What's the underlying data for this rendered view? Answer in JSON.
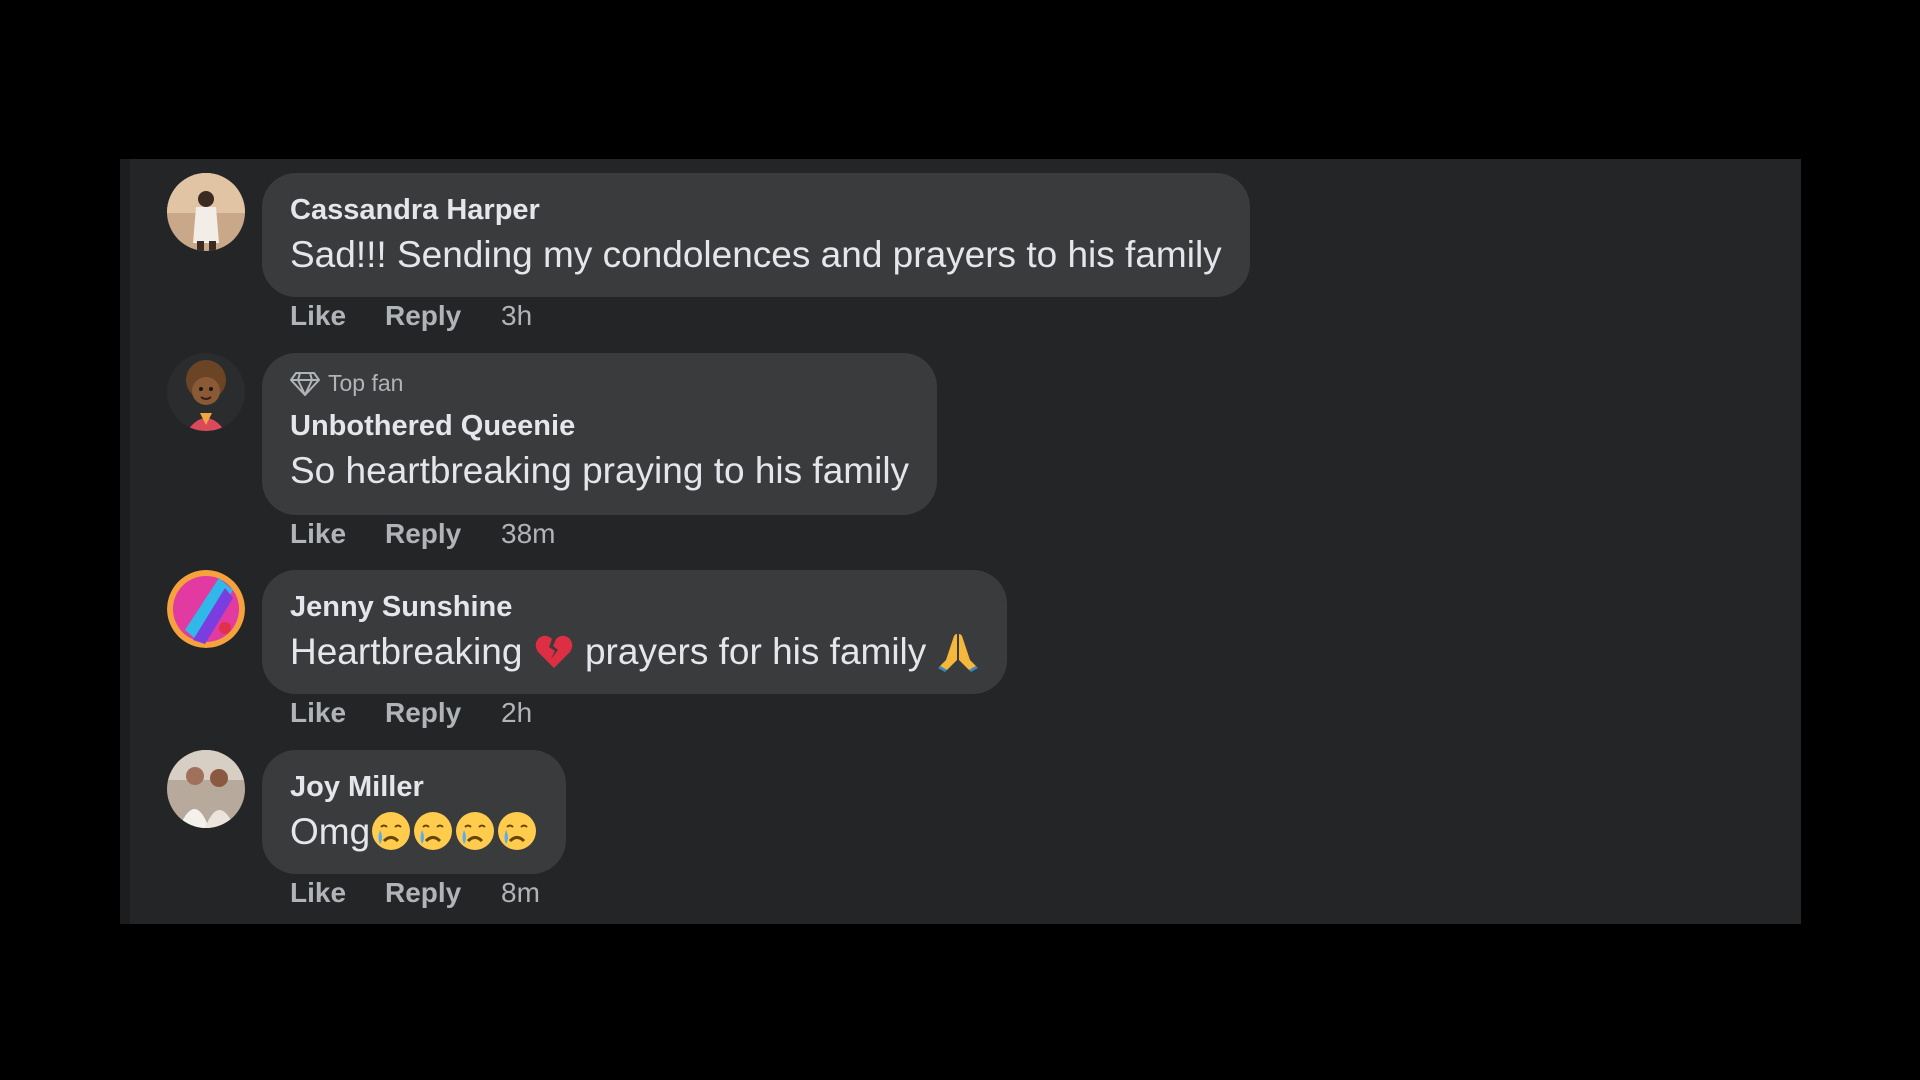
{
  "comments": [
    {
      "author": "Cassandra Harper",
      "badge": "",
      "text": "Sad!!! Sending my condolences and prayers to his family",
      "like": "Like",
      "reply": "Reply",
      "time": "3h"
    },
    {
      "author": "Unbothered Queenie",
      "badge": "Top fan",
      "text": "So heartbreaking praying to his family",
      "like": "Like",
      "reply": "Reply",
      "time": "38m"
    },
    {
      "author": "Jenny Sunshine",
      "badge": "",
      "text_part1": "Heartbreaking",
      "text_part2": "prayers for his family",
      "emojis": [
        "broken-heart-icon",
        "folded-hands-icon"
      ],
      "like": "Like",
      "reply": "Reply",
      "time": "2h"
    },
    {
      "author": "Joy Miller",
      "badge": "",
      "text": "Omg",
      "emojis": [
        "crying-face-icon",
        "crying-face-icon",
        "crying-face-icon",
        "crying-face-icon"
      ],
      "like": "Like",
      "reply": "Reply",
      "time": "8m"
    }
  ],
  "colors": {
    "background": "#000000",
    "panel": "#242526",
    "bubble": "#3a3b3c",
    "primary_text": "#e4e6eb",
    "secondary_text": "#b0b3b8"
  }
}
